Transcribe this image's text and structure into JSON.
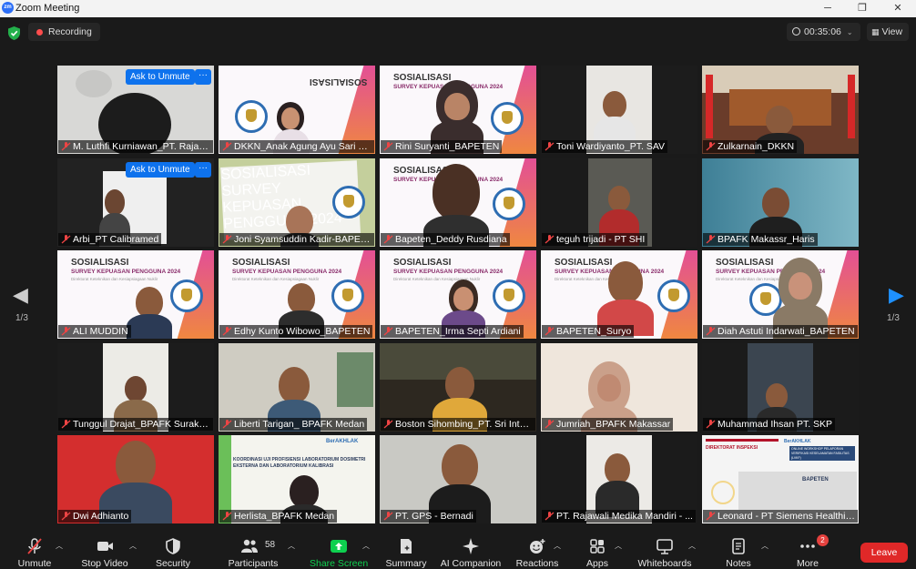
{
  "window": {
    "title": "Zoom Meeting",
    "logo": "zm"
  },
  "topbar": {
    "recording": "Recording",
    "timer": "00:35:06",
    "view": "View"
  },
  "nav": {
    "page_left": "1/3",
    "page_right": "1/3"
  },
  "overlay": {
    "ask_unmute": "Ask to Unmute",
    "more": "···"
  },
  "tiles": [
    {
      "name": "M. Luthfi Kurniawan_PT. Rajawa..."
    },
    {
      "name": "DKKN_Anak Agung Ayu Sari Tri..."
    },
    {
      "name": "Rini Suryanti_BAPETEN"
    },
    {
      "name": "Toni Wardiyanto_PT. SAV"
    },
    {
      "name": "Zulkarnain_DKKN"
    },
    {
      "name": "Arbi_PT Calibramed"
    },
    {
      "name": "Joni Syamsuddin Kadir-BAPETEN"
    },
    {
      "name": "Bapeten_Deddy Rusdiana"
    },
    {
      "name": "teguh trijadi - PT SHI"
    },
    {
      "name": "BPAFK Makassr_Haris"
    },
    {
      "name": "ALI MUDDIN"
    },
    {
      "name": "Edhy Kunto Wibowo_BAPETEN"
    },
    {
      "name": "BAPETEN_Irma Septi Ardiani"
    },
    {
      "name": "BAPETEN_Suryo"
    },
    {
      "name": "Diah Astuti Indarwati_BAPETEN"
    },
    {
      "name": "Tunggul Drajat_BPAFK Surakarta"
    },
    {
      "name": "Liberti Tarigan_ BPAFK Medan"
    },
    {
      "name": "Boston Sihombing_PT. Sri Intan ..."
    },
    {
      "name": "Jumriah_BPAFK Makassar"
    },
    {
      "name": "Muhammad Ihsan PT. SKP"
    },
    {
      "name": "Dwi Adhianto"
    },
    {
      "name": "Herlista_BPAFK Medan"
    },
    {
      "name": "PT. GPS - Bernadi"
    },
    {
      "name": "PT. Rajawali Medika Mandiri - ..."
    },
    {
      "name": "Leonard - PT Siemens Healthin..."
    }
  ],
  "slide": {
    "title": "SOSIALISASI",
    "subtitle": "SURVEY KEPUASAN PENGGUNA 2024",
    "small": "Direktorat Keteknikan dan Kesiapsiagaan Nuklir",
    "seal_text": "BAPETEN"
  },
  "slide_kalibrasi": {
    "title": "KOORDINASI UJI PROFISIENSI LABORATORIUM DOSIMETRI EKSTERNA DAN LABORATORIUM KALIBRASI",
    "logo": "BerAKHLAK"
  },
  "slide_workshop": {
    "title": "DIREKTORAT INSPEKSI",
    "logo": "BerAKHLAK",
    "sub": "ONLINE WORKSHOP PELAPORAN VERIFIKASI KESELAMATAN FASILITAS (LVKF)",
    "building": "BAPETEN"
  },
  "toolbar": {
    "unmute": "Unmute",
    "stop_video": "Stop Video",
    "security": "Security",
    "participants": "Participants",
    "participants_count": "58",
    "share_screen": "Share Screen",
    "summary": "Summary",
    "ai_companion": "AI Companion",
    "reactions": "Reactions",
    "apps": "Apps",
    "whiteboards": "Whiteboards",
    "notes": "Notes",
    "more": "More",
    "more_badge": "2",
    "leave": "Leave"
  },
  "colors": {
    "accent": "#0e72ed",
    "speaker": "#9ed24a",
    "leave": "#e02828",
    "share": "#0ed04f",
    "recording": "#ff4d4d"
  }
}
